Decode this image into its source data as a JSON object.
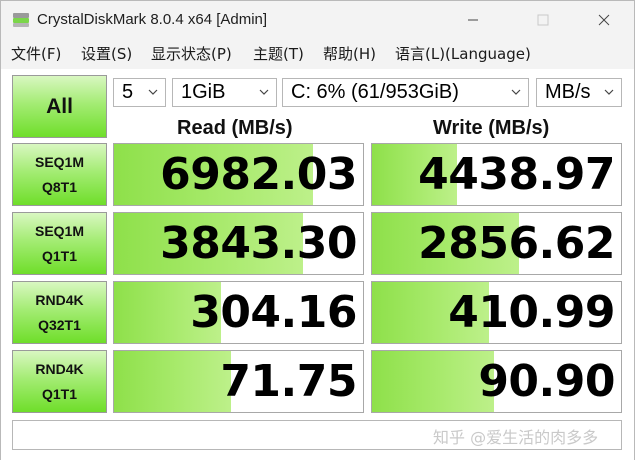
{
  "window": {
    "title": "CrystalDiskMark 8.0.4 x64 [Admin]"
  },
  "menu": [
    "文件(F)",
    "设置(S)",
    "显示状态(P)",
    "主题(T)",
    "帮助(H)",
    "语言(L)(Language)"
  ],
  "controls": {
    "all_label": "All",
    "count": "5",
    "size": "1GiB",
    "drive": "C: 6% (61/953GiB)",
    "unit": "MB/s"
  },
  "headers": {
    "read": "Read (MB/s)",
    "write": "Write (MB/s)"
  },
  "rows": [
    {
      "l1": "SEQ1M",
      "l2": "Q8T1",
      "read": "6982.03",
      "read_fill": 0.8,
      "write": "4438.97",
      "write_fill": 0.34
    },
    {
      "l1": "SEQ1M",
      "l2": "Q1T1",
      "read": "3843.30",
      "read_fill": 0.76,
      "write": "2856.62",
      "write_fill": 0.59
    },
    {
      "l1": "RND4K",
      "l2": "Q32T1",
      "read": "304.16",
      "read_fill": 0.43,
      "write": "410.99",
      "write_fill": 0.47
    },
    {
      "l1": "RND4K",
      "l2": "Q1T1",
      "read": "71.75",
      "read_fill": 0.47,
      "write": "90.90",
      "write_fill": 0.49
    }
  ],
  "comment": "",
  "watermark": "知乎 @爱生活的肉多多",
  "colors": {
    "green_dark": "#6fde2a",
    "green_light": "#d9f7c1",
    "bar": "#a8ea6c"
  }
}
